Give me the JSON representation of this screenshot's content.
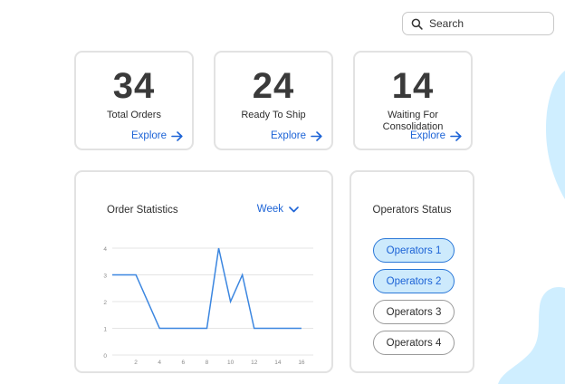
{
  "search": {
    "placeholder": "Search"
  },
  "stats": [
    {
      "value": "34",
      "label": "Total Orders",
      "link": "Explore"
    },
    {
      "value": "24",
      "label": "Ready To Ship",
      "link": "Explore"
    },
    {
      "value": "14",
      "label_line1": "Waiting For",
      "label_line2": "Consolidation",
      "link": "Explore"
    }
  ],
  "order_statistics": {
    "title": "Order Statistics",
    "period": "Week"
  },
  "chart_data": {
    "type": "line",
    "title": "Order Statistics",
    "x": [
      0,
      2,
      4,
      6,
      8,
      9,
      10,
      11,
      12,
      16
    ],
    "y": [
      3,
      3,
      1,
      1,
      1,
      4,
      2,
      3,
      1,
      1
    ],
    "x_ticks": [
      2,
      4,
      6,
      8,
      10,
      12,
      14,
      16
    ],
    "y_ticks": [
      0,
      1,
      2,
      3,
      4
    ],
    "xlim": [
      0,
      17
    ],
    "ylim": [
      0,
      4
    ],
    "grid": true,
    "color": "#3b86e0"
  },
  "operators": {
    "title": "Operators Status",
    "items": [
      {
        "label": "Operators 1",
        "active": true
      },
      {
        "label": "Operators 2",
        "active": true
      },
      {
        "label": "Operators 3",
        "active": false
      },
      {
        "label": "Operators 4",
        "active": false
      }
    ]
  },
  "colors": {
    "accent": "#1c63d6",
    "active_fill": "#cdeafc",
    "blob": "#cfeeff"
  }
}
